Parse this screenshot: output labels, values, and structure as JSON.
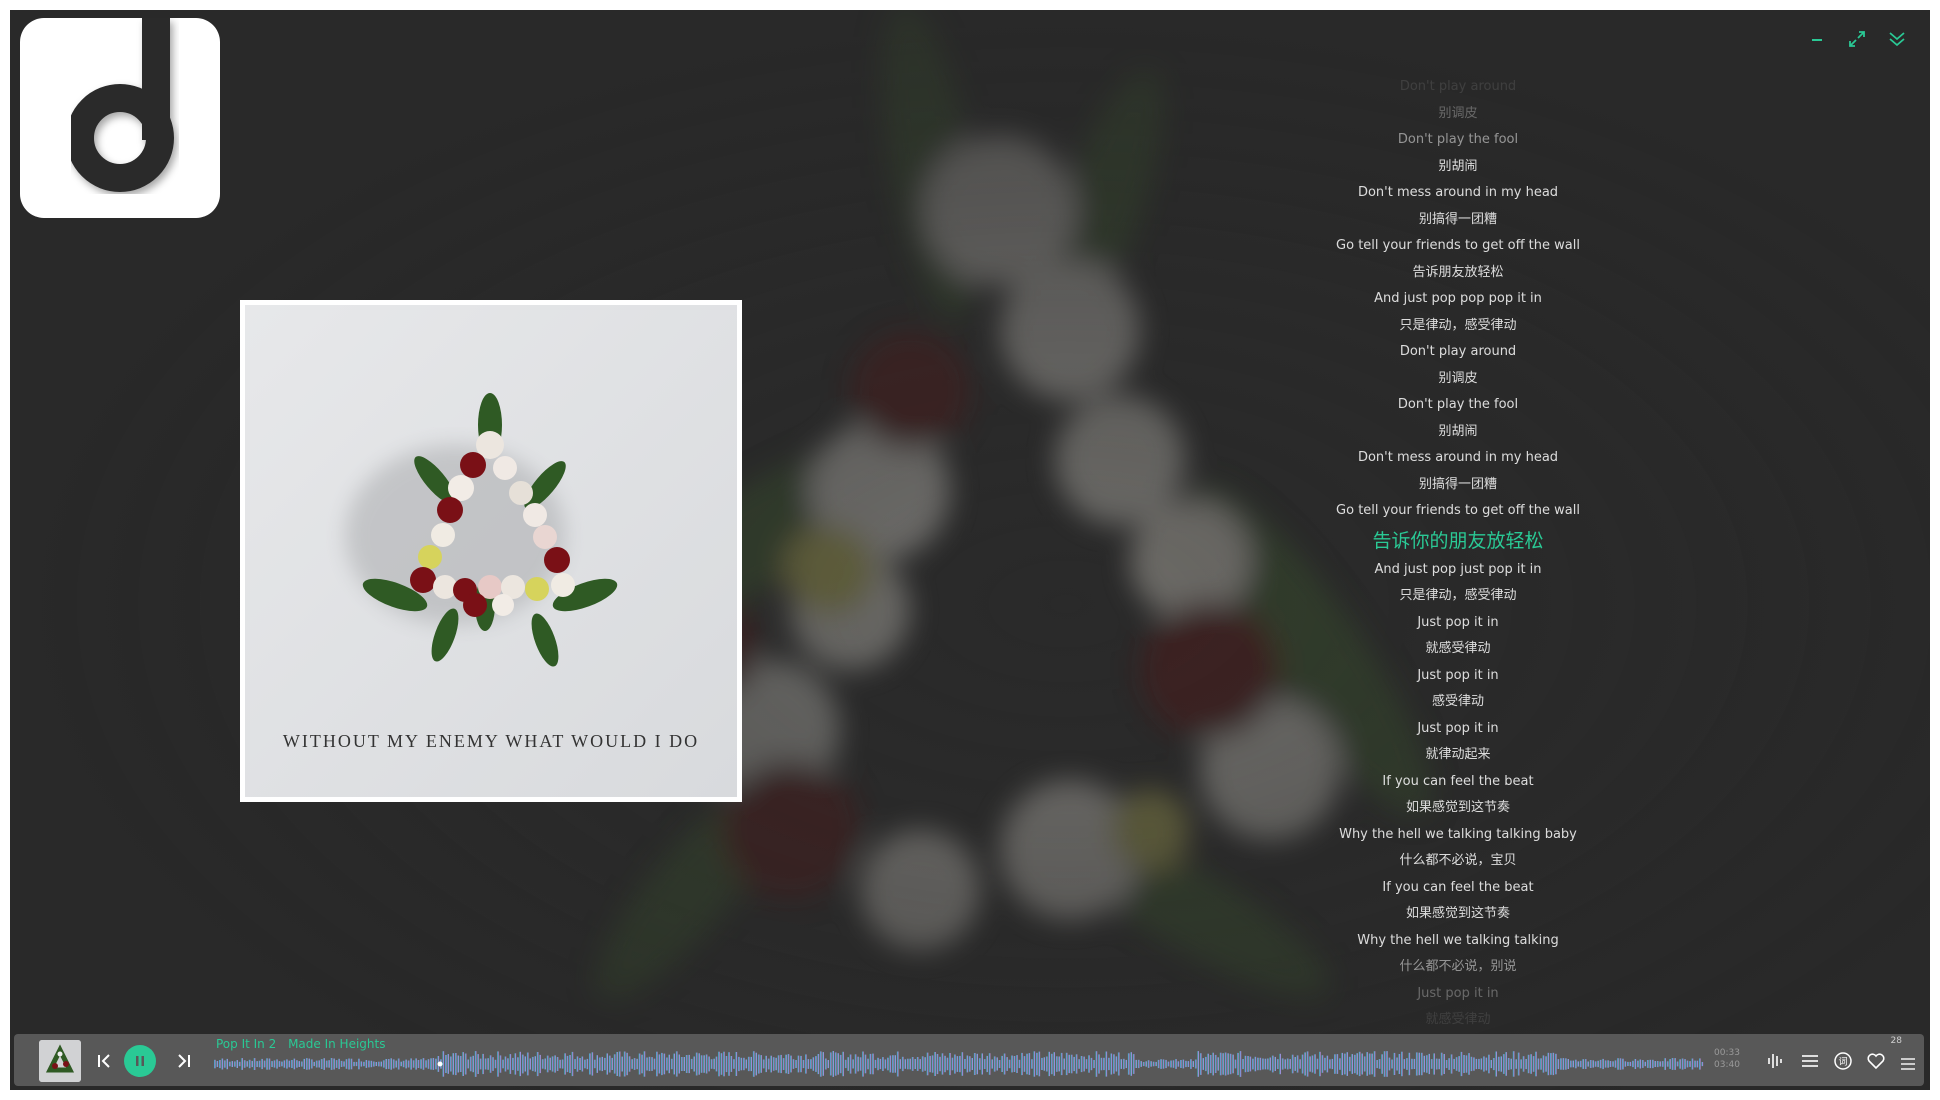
{
  "logo": {
    "icon": "music-note-d-logo"
  },
  "cover": {
    "text": "WITHOUT MY ENEMY WHAT WOULD I DO"
  },
  "window": {
    "minimize_icon": "minimize-icon",
    "fullscreen_icon": "expand-icon",
    "collapse_icon": "chevron-double-down-icon",
    "accent": "#2ac995"
  },
  "lyrics": {
    "lines": [
      "Don't play around",
      "别调皮",
      "Don't play the fool",
      "别胡闹",
      "Don't mess around in my head",
      "别搞得一团糟",
      "Go tell your friends to get off the wall",
      "告诉朋友放轻松",
      "And just pop pop pop it in",
      "只是律动，感受律动",
      "Don't play around",
      "别调皮",
      "Don't play the fool",
      "别胡闹",
      "Don't mess around in my head",
      "别搞得一团糟",
      "Go tell your friends to get off the wall",
      "告诉你的朋友放轻松",
      "And just pop just pop it in",
      "只是律动，感受律动",
      "Just pop it in",
      "就感受律动",
      "Just pop it in",
      "感受律动",
      "Just pop it in",
      "就律动起来",
      "If you can feel the beat",
      "如果感觉到这节奏",
      "Why the hell we talking talking baby",
      "什么都不必说，宝贝",
      "If you can feel the beat",
      "如果感觉到这节奏",
      "Why the hell we talking talking",
      "什么都不必说，别说",
      "Just pop it in",
      "就感受律动"
    ],
    "active_index": 17
  },
  "player": {
    "song": "Pop It In 2",
    "artist": "Made In Heights",
    "current_time": "00:33",
    "total_time": "03:40",
    "volume": "28",
    "accent": "#2ac995",
    "wave_start": "#2bc0a6",
    "wave_mid": "#6a8fd8",
    "wave_end": "#d48fd6"
  }
}
